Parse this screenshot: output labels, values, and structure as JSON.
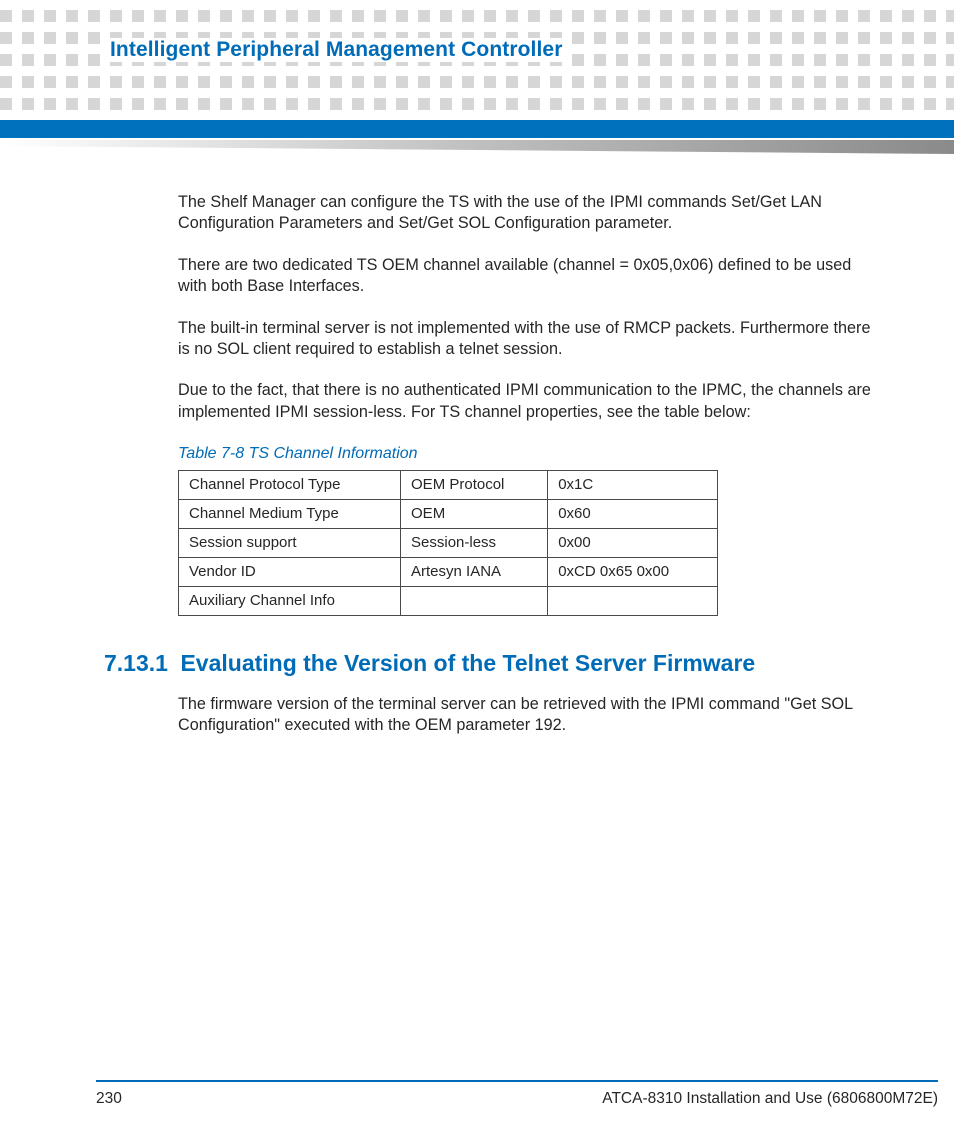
{
  "header": {
    "chapter_title": "Intelligent Peripheral Management Controller"
  },
  "body": {
    "p1": "The Shelf Manager can configure the TS with the use of the IPMI commands Set/Get LAN Configuration Parameters and Set/Get SOL Configuration parameter.",
    "p2": "There are two dedicated TS OEM channel available (channel = 0x05,0x06) defined to be used with both Base Interfaces.",
    "p3": "The built-in terminal server is not implemented with the use of RMCP packets. Furthermore there is no SOL client required to establish a telnet session.",
    "p4": "Due to the fact, that there is no authenticated IPMI communication to the IPMC, the channels are implemented IPMI session-less. For TS channel properties, see the table below:"
  },
  "table": {
    "caption": "Table 7-8 TS Channel Information",
    "rows": [
      {
        "c0": "Channel Protocol Type",
        "c1": "OEM Protocol",
        "c2": "0x1C"
      },
      {
        "c0": "Channel Medium Type",
        "c1": "OEM",
        "c2": "0x60"
      },
      {
        "c0": "Session support",
        "c1": "Session-less",
        "c2": "0x00"
      },
      {
        "c0": "Vendor ID",
        "c1": "Artesyn IANA",
        "c2": "0xCD 0x65 0x00"
      },
      {
        "c0": "Auxiliary Channel Info",
        "c1": "",
        "c2": ""
      }
    ]
  },
  "section": {
    "number": "7.13.1",
    "title": "Evaluating the Version of the Telnet Server Firmware",
    "p1": "The firmware version of the terminal server can be retrieved with the IPMI command \"Get SOL Configuration\" executed with the OEM parameter 192."
  },
  "footer": {
    "page": "230",
    "doc": "ATCA-8310 Installation and Use (6806800M72E)"
  }
}
